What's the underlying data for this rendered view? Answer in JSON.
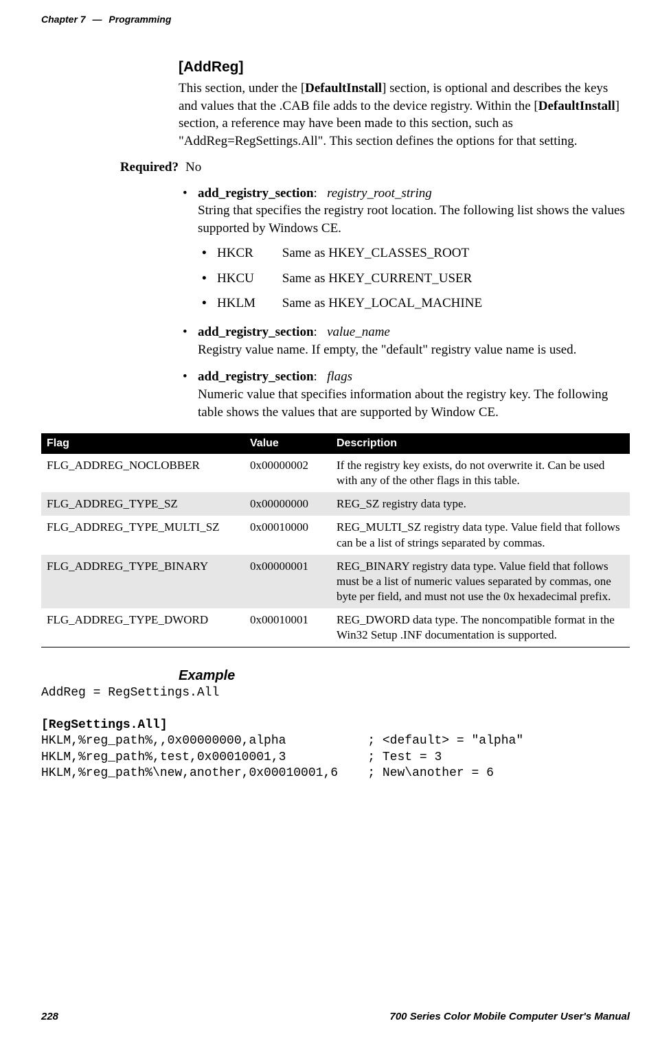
{
  "header": {
    "chapter_label": "Chapter 7",
    "dash": "—",
    "chapter_title": "Programming"
  },
  "section": {
    "title": "[AddReg]",
    "intro_pre": "This section, under the [",
    "intro_bold1": "DefaultInstall",
    "intro_mid1": "] section, is optional and describes the keys and values that the .CAB file adds to the device registry. Within the [",
    "intro_bold2": "DefaultInstall",
    "intro_post": "] section, a reference may have been made to this section, such as \"AddReg=RegSettings.All\". This section defines the options for that setting."
  },
  "required": {
    "label": "Required?",
    "value": "No"
  },
  "bullets": [
    {
      "term": "add_registry_section",
      "param": "registry_root_string",
      "desc": "String that specifies the registry root location. The following list shows the values supported by Windows CE.",
      "inner": [
        {
          "key": "HKCR",
          "val": "Same as HKEY_CLASSES_ROOT"
        },
        {
          "key": "HKCU",
          "val": "Same as HKEY_CURRENT_USER"
        },
        {
          "key": "HKLM",
          "val": "Same as HKEY_LOCAL_MACHINE"
        }
      ]
    },
    {
      "term": "add_registry_section",
      "param": "value_name",
      "desc": "Registry value name. If empty, the \"default\" registry value name is used."
    },
    {
      "term": "add_registry_section",
      "param": "flags",
      "desc": "Numeric value that specifies information about the registry key. The following table shows the values that are supported by Window CE."
    }
  ],
  "table": {
    "headers": {
      "c1": "Flag",
      "c2": "Value",
      "c3": "Description"
    },
    "rows": [
      {
        "flag": "FLG_ADDREG_NOCLOBBER",
        "value": "0x00000002",
        "desc": "If the registry key exists, do not overwrite it. Can be used with any of the other flags in this table."
      },
      {
        "flag": "FLG_ADDREG_TYPE_SZ",
        "value": "0x00000000",
        "desc": "REG_SZ registry data type."
      },
      {
        "flag": "FLG_ADDREG_TYPE_MULTI_SZ",
        "value": "0x00010000",
        "desc": "REG_MULTI_SZ registry data type. Value field that follows can be a list of strings separated by commas."
      },
      {
        "flag": "FLG_ADDREG_TYPE_BINARY",
        "value": "0x00000001",
        "desc": "REG_BINARY registry data type. Value field that follows must be a list of numeric values separated by commas, one byte per field, and must not use the 0x hexadecimal prefix."
      },
      {
        "flag": "FLG_ADDREG_TYPE_DWORD",
        "value": "0x00010001",
        "desc": "REG_DWORD data type. The noncompatible format in the Win32 Setup .INF documentation is supported."
      }
    ]
  },
  "example": {
    "title": "Example",
    "line1": "AddReg = RegSettings.All",
    "section_header": "[RegSettings.All]",
    "line2": "HKLM,%reg_path%,,0x00000000,alpha           ; <default> = \"alpha\"",
    "line3": "HKLM,%reg_path%,test,0x00010001,3           ; Test = 3",
    "line4": "HKLM,%reg_path%\\new,another,0x00010001,6    ; New\\another = 6"
  },
  "footer": {
    "page": "228",
    "title": "700 Series Color Mobile Computer User's Manual"
  }
}
